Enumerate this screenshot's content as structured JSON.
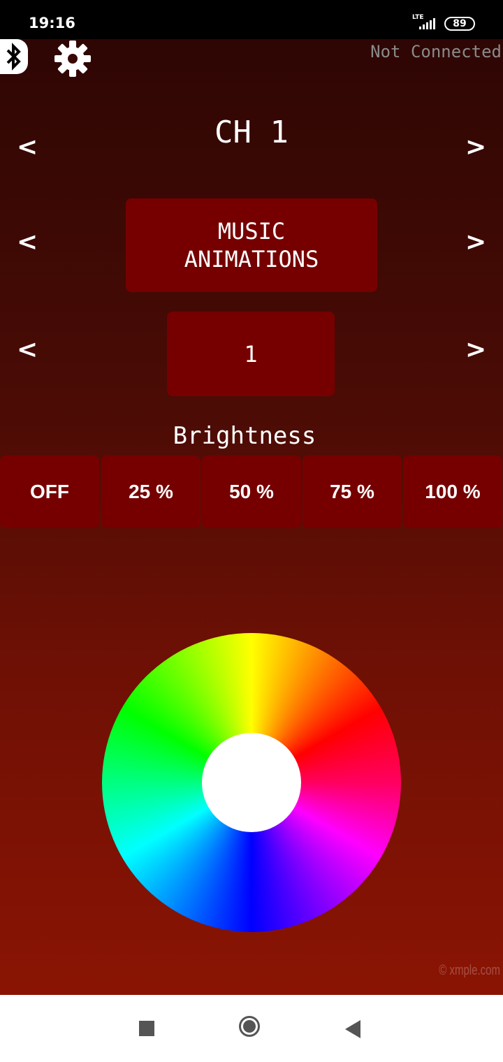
{
  "status_bar": {
    "time": "19:16",
    "network": "LTE",
    "battery": "89"
  },
  "header": {
    "bluetooth_icon": "bluetooth-icon",
    "settings_icon": "gear-icon",
    "connection_status": "Not Connected"
  },
  "channel": {
    "title": "CH 1",
    "prev": "<",
    "next": ">"
  },
  "mode": {
    "line1": "MUSIC",
    "line2": "ANIMATIONS",
    "prev": "<",
    "next": ">"
  },
  "animation": {
    "value": "1",
    "prev": "<",
    "next": ">"
  },
  "brightness": {
    "label": "Brightness",
    "options": [
      "OFF",
      "25 %",
      "50 %",
      "75 %",
      "100 %"
    ]
  },
  "color_wheel": {
    "icon": "color-wheel"
  },
  "watermark": "© xmple.com",
  "colors": {
    "button_bg": "#760000",
    "status_text": "#8a8a8a"
  }
}
